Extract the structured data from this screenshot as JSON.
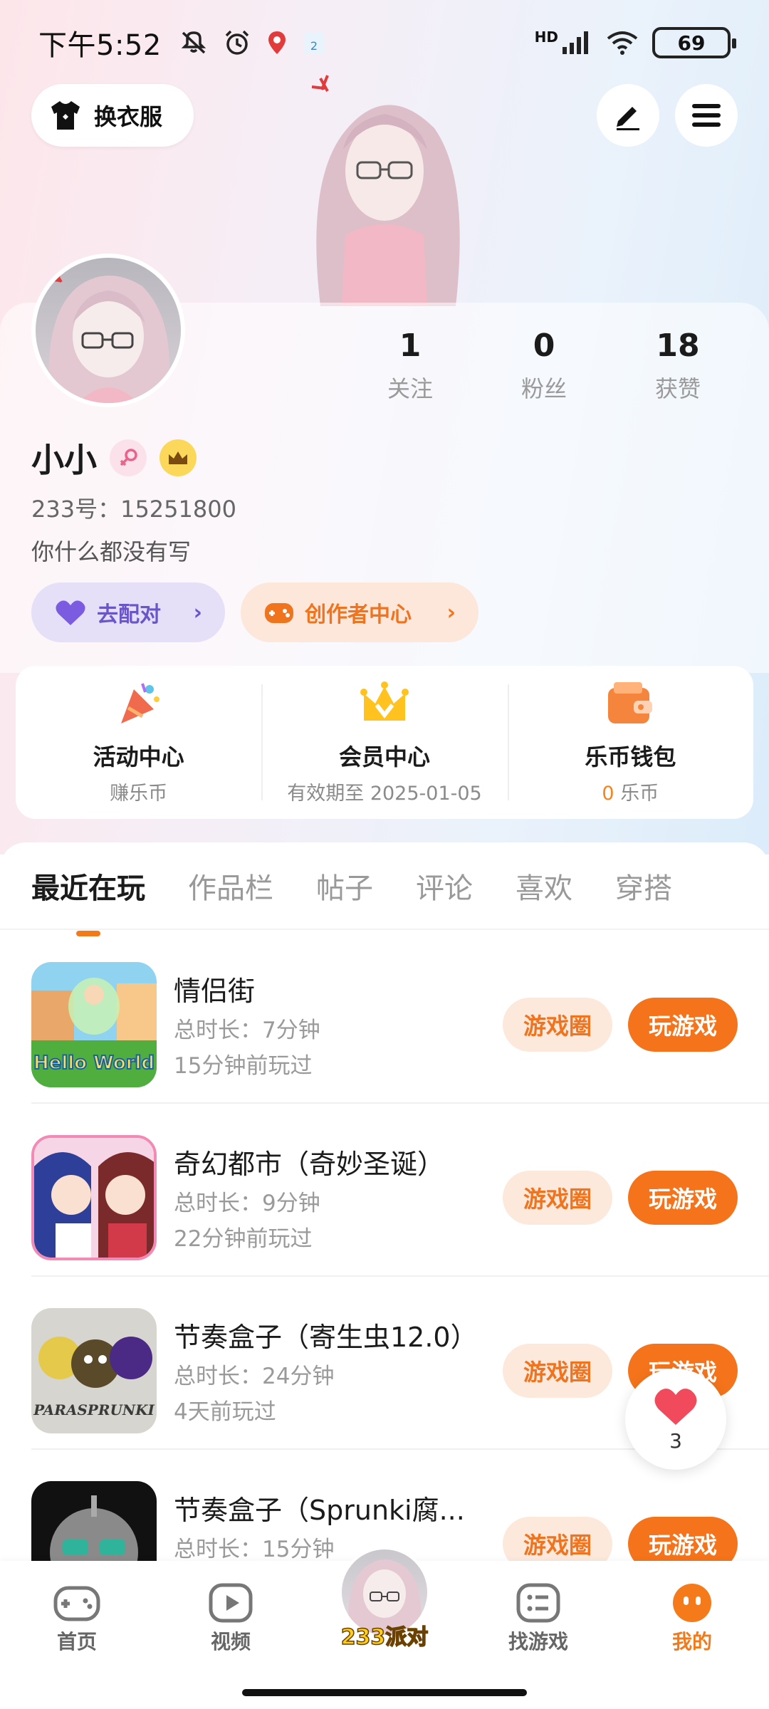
{
  "status_bar": {
    "time": "下午5:52",
    "network": "HD",
    "battery": "69"
  },
  "header": {
    "outfit_label": "换衣服"
  },
  "profile": {
    "name": "小小",
    "uid": "233号：15251800",
    "bio": "你什么都没有写",
    "stats": [
      {
        "value": "1",
        "label": "关注"
      },
      {
        "value": "0",
        "label": "粉丝"
      },
      {
        "value": "18",
        "label": "获赞"
      }
    ],
    "match_label": "去配对",
    "creator_label": "创作者中心"
  },
  "features": [
    {
      "title": "活动中心",
      "sub": "赚乐币"
    },
    {
      "title": "会员中心",
      "sub": "有效期至 2025-01-05"
    },
    {
      "title": "乐币钱包",
      "sub_value": "0",
      "sub_unit": "乐币"
    }
  ],
  "tabs": [
    "最近在玩",
    "作品栏",
    "帖子",
    "评论",
    "喜欢",
    "穿搭"
  ],
  "games": [
    {
      "title": "情侣街",
      "duration": "总时长：7分钟",
      "ago": "15分钟前玩过",
      "thumb_text": "Hello World"
    },
    {
      "title": "奇幻都市（奇妙圣诞）",
      "duration": "总时长：9分钟",
      "ago": "22分钟前玩过",
      "thumb_text": ""
    },
    {
      "title": "节奏盒子（寄生虫12.0）",
      "duration": "总时长：24分钟",
      "ago": "4天前玩过",
      "thumb_text": "PARASPRUNKI"
    },
    {
      "title": "节奏盒子（Sprunki腐...",
      "duration": "总时长：15分钟",
      "ago": "",
      "thumb_text": ""
    }
  ],
  "game_actions": {
    "circle": "游戏圈",
    "play": "玩游戏"
  },
  "like_float": {
    "count": "3"
  },
  "bottom_nav": {
    "home": "首页",
    "video": "视频",
    "center": "233派对",
    "find": "找游戏",
    "me": "我的"
  },
  "colors": {
    "accent": "#f5741b",
    "match": "#6a56c8"
  }
}
